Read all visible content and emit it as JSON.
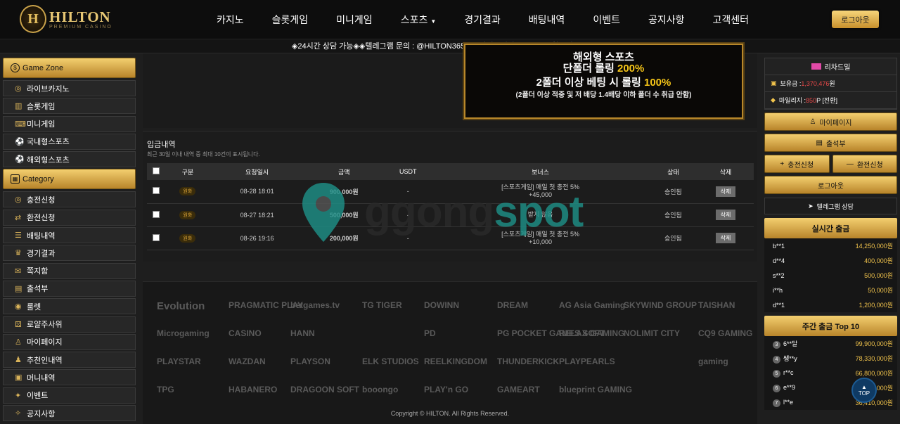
{
  "brand": {
    "name": "HILTON",
    "sub": "PREMIUM CASINO",
    "badge": "H"
  },
  "nav": [
    "카지노",
    "슬롯게임",
    "미니게임",
    "스포츠",
    "경기결과",
    "배팅내역",
    "이벤트",
    "공지사항",
    "고객센터"
  ],
  "logout_top": "로그아웃",
  "ticker": "◈24시간 상담 가능◈◈텔레그램 문의 : @HILTON365 ◈◈평생도메인 한글주소 : 힐튼접속.COM ◈",
  "left": {
    "game_zone": "Game Zone",
    "games": [
      {
        "label": "라이브카지노",
        "icon": "chip-icon"
      },
      {
        "label": "슬롯게임",
        "icon": "slot-icon"
      },
      {
        "label": "미니게임",
        "icon": "gamepad-icon"
      },
      {
        "label": "국내형스포츠",
        "icon": "ball-icon"
      },
      {
        "label": "해외형스포츠",
        "icon": "ball-icon"
      }
    ],
    "category": "Category",
    "cats": [
      {
        "label": "충전신청",
        "icon": "coin-icon"
      },
      {
        "label": "환전신청",
        "icon": "exchange-icon"
      },
      {
        "label": "배팅내역",
        "icon": "list-icon"
      },
      {
        "label": "경기결과",
        "icon": "trophy-icon"
      },
      {
        "label": "쪽지함",
        "icon": "mail-icon"
      },
      {
        "label": "출석부",
        "icon": "calendar-icon"
      },
      {
        "label": "룰렛",
        "icon": "roulette-icon"
      },
      {
        "label": "로얄주사위",
        "icon": "dice-icon"
      },
      {
        "label": "마이페이지",
        "icon": "user-icon"
      },
      {
        "label": "추천인내역",
        "icon": "users-icon"
      },
      {
        "label": "머니내역",
        "icon": "wallet-icon"
      },
      {
        "label": "이벤트",
        "icon": "gift-icon"
      },
      {
        "label": "공지사항",
        "icon": "megaphone-icon"
      }
    ]
  },
  "banner": {
    "l1": "해외형 스포츠",
    "l2a": "단폴더 롤링 ",
    "l2b": "200%",
    "l3a": "2폴더 이상 베팅 시 롤링 ",
    "l3b": "100%",
    "l4": "(2폴더 이상 적중 및 저 배당 1.4배당 이하 폴더 수 취급 안함)"
  },
  "deposit": {
    "title": "입금내역",
    "subtitle": "최근 30일 이내 내역 중 최대 10건이 표시됩니다.",
    "headers": [
      "구분",
      "요청일시",
      "금액",
      "USDT",
      "보너스",
      "상태",
      "삭제"
    ],
    "rows": [
      {
        "type": "원화",
        "date": "08-28 18:01",
        "amount": "900,000원",
        "usdt": "-",
        "bonus1": "[스포츠게임] 매일 첫 충전 5%",
        "bonus2": "+45,000",
        "status": "승인됨",
        "del": "삭제"
      },
      {
        "type": "원화",
        "date": "08-27 18:21",
        "amount": "500,000원",
        "usdt": "-",
        "bonus1": "받지 않음",
        "bonus2": "",
        "status": "승인됨",
        "del": "삭제"
      },
      {
        "type": "원화",
        "date": "08-26 19:16",
        "amount": "200,000원",
        "usdt": "-",
        "bonus1": "[스포츠게임] 매일 첫 충전 5%",
        "bonus2": "+10,000",
        "status": "승인됨",
        "del": "삭제"
      }
    ]
  },
  "watermark": {
    "a": "ggong",
    "b": "spot"
  },
  "providers": [
    "Evolution",
    "PRAGMATIC PLAY",
    "betgames.tv",
    "TG TIGER",
    "DOWINN",
    "DREAM",
    "AG Asia Gaming",
    "SKYWIND GROUP",
    "TAISHAN",
    "Microgaming",
    "CASINO",
    "HANN",
    "",
    "PD",
    "PG POCKET GAMES SOFT",
    "RELAX GAMING",
    "NOLIMIT CITY",
    "CQ9 GAMING",
    "PLAYSTAR",
    "WAZDAN",
    "PLAYSON",
    "ELK STUDIOS",
    "REELKINGDOM",
    "THUNDERKICK",
    "PLAYPEARLS",
    "",
    "gaming",
    "TPG",
    "HABANERO",
    "DRAGOON SOFT",
    "booongo",
    "PLAY'n GO",
    "GAMEART",
    "blueprint GAMING"
  ],
  "copyright": "Copyright © HILTON. All Rights Reserved.",
  "right": {
    "username": "리차드밀",
    "balance_label": "보유금 : ",
    "balance": "1,370,476",
    "balance_unit": " 원",
    "mileage_label": "마일리지 : ",
    "mileage": "850",
    "mileage_unit": " P [전환]",
    "mypage": "마이페이지",
    "attendance": "출석부",
    "charge": "충전신청",
    "exchange": "환전신청",
    "logout": "로그아웃",
    "telegram": "텔레그램 상담",
    "live_title": "실시간 출금",
    "live": [
      {
        "u": "b**1",
        "v": "14,250,000원"
      },
      {
        "u": "d**4",
        "v": "400,000원"
      },
      {
        "u": "s**2",
        "v": "500,000원"
      },
      {
        "u": "i**h",
        "v": "50,000원"
      },
      {
        "u": "d**1",
        "v": "1,200,000원"
      }
    ],
    "weekly_title": "주간 출금 Top 10",
    "weekly": [
      {
        "n": "3",
        "u": "6**달",
        "v": "99,900,000원"
      },
      {
        "n": "4",
        "u": "쌩**y",
        "v": "78,330,000원"
      },
      {
        "n": "5",
        "u": "r**c",
        "v": "66,800,000원"
      },
      {
        "n": "6",
        "u": "e**9",
        "v": "44,590,000원"
      },
      {
        "n": "7",
        "u": "l**e",
        "v": "36,410,000원"
      }
    ]
  },
  "top_btn": "TOP",
  "colors": {
    "gold": "#d9a844",
    "bg": "#1e1e1e",
    "approved": "#2fbf4f",
    "teal": "#1e8f87"
  }
}
